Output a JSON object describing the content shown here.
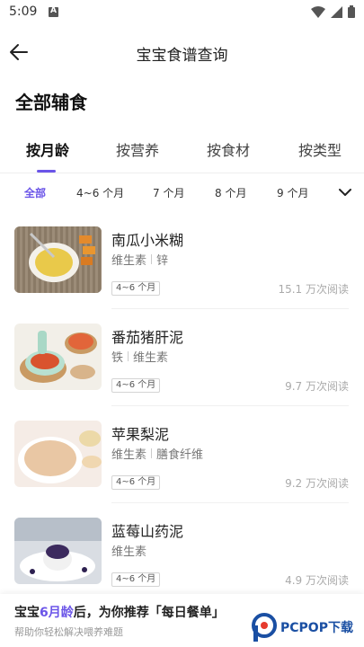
{
  "status_bar": {
    "time": "5:09"
  },
  "header": {
    "title": "宝宝食谱查询"
  },
  "section": {
    "title": "全部辅食"
  },
  "tabs": [
    {
      "label": "按月龄",
      "active": true
    },
    {
      "label": "按营养",
      "active": false
    },
    {
      "label": "按食材",
      "active": false
    },
    {
      "label": "按类型",
      "active": false
    }
  ],
  "age_filter": [
    {
      "label": "全部",
      "active": true
    },
    {
      "label": "4~6 个月",
      "active": false
    },
    {
      "label": "7 个月",
      "active": false
    },
    {
      "label": "8 个月",
      "active": false
    },
    {
      "label": "9 个月",
      "active": false
    }
  ],
  "recipes": [
    {
      "name": "南瓜小米糊",
      "tags": [
        "维生素",
        "锌"
      ],
      "age": "4~6 个月",
      "reads": "15.1 万次阅读"
    },
    {
      "name": "番茄猪肝泥",
      "tags": [
        "铁",
        "维生素"
      ],
      "age": "4~6 个月",
      "reads": "9.7 万次阅读"
    },
    {
      "name": "苹果梨泥",
      "tags": [
        "维生素",
        "膳食纤维"
      ],
      "age": "4~6 个月",
      "reads": "9.2 万次阅读"
    },
    {
      "name": "蓝莓山药泥",
      "tags": [
        "维生素"
      ],
      "age": "4~6 个月",
      "reads": "4.9 万次阅读"
    }
  ],
  "banner": {
    "prefix": "宝宝",
    "highlight": "6月龄",
    "suffix": "后，为你推荐「每日餐单」",
    "subtitle": "帮助你轻松解决喂养难题"
  },
  "watermark": {
    "text": "PCPOP下载"
  },
  "colors": {
    "accent": "#6b55e8",
    "muted": "#aaaaaa"
  }
}
